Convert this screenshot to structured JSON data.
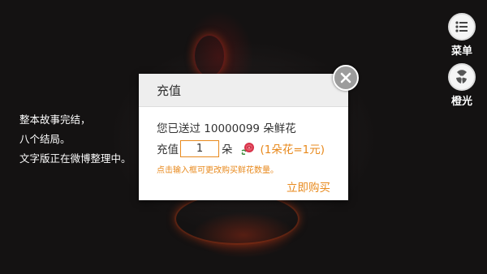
{
  "story": {
    "lines": [
      "整本故事完结，",
      "八个结局。",
      "文字版正在微博整理中。"
    ]
  },
  "side_buttons": {
    "menu_label": "菜单",
    "orange_label": "橙光"
  },
  "recharge_dialog": {
    "title": "充值",
    "sent_line": "您已送过 10000099 朵鲜花",
    "recharge_label": "充值",
    "amount_value": "1",
    "unit": "朵",
    "rate": "(1朵花=1元)",
    "hint": "点击输入框可更改购买鲜花数量。",
    "buy_label": "立即购买"
  },
  "colors": {
    "accent": "#e8891c",
    "dialog_header_bg": "#eeeeee",
    "background": "#141212"
  },
  "icons": {
    "menu": "menu-list-icon",
    "orange": "orange-slices-icon",
    "close": "close-icon",
    "flower": "rose-flower-icon"
  }
}
